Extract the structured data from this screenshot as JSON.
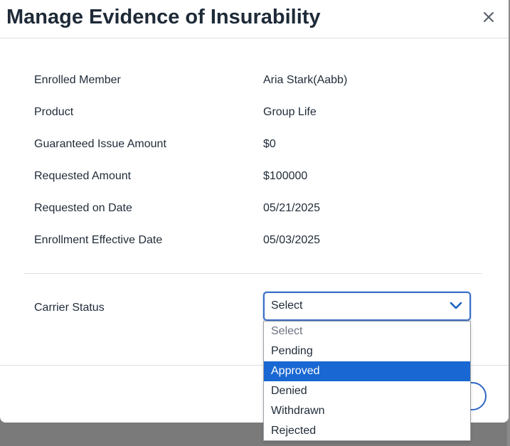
{
  "modal": {
    "title": "Manage Evidence of Insurability",
    "close_icon": "close-icon"
  },
  "details": [
    {
      "label": "Enrolled Member",
      "value": "Aria Stark(Aabb)"
    },
    {
      "label": "Product",
      "value": "Group Life"
    },
    {
      "label": "Guaranteed Issue Amount",
      "value": "$0"
    },
    {
      "label": "Requested Amount",
      "value": "$100000"
    },
    {
      "label": "Requested on Date",
      "value": "05/21/2025"
    },
    {
      "label": "Enrollment Effective Date",
      "value": "05/03/2025"
    }
  ],
  "carrier_status": {
    "label": "Carrier Status",
    "selected": "Select",
    "chevron_icon": "chevron-down-icon",
    "options": [
      "Select",
      "Pending",
      "Approved",
      "Denied",
      "Withdrawn",
      "Rejected"
    ],
    "highlighted": "Approved"
  },
  "colors": {
    "accent": "#1967d2",
    "focus_border": "#3b6fc4",
    "title_text": "#1e2a38",
    "backdrop": "#7a7a7a"
  }
}
